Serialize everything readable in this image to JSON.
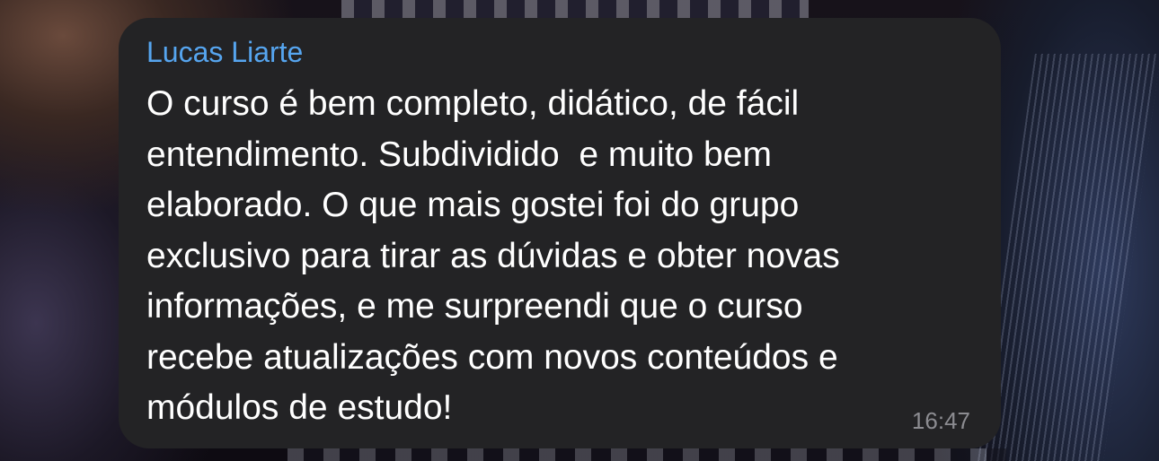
{
  "message": {
    "sender": "Lucas Liarte",
    "lines": [
      "O curso é bem completo, didático, de fácil",
      "entendimento. Subdividido  e muito bem",
      "elaborado. O que mais gostei foi do grupo",
      "exclusivo para tirar as dúvidas e obter novas",
      "informações, e me surpreendi que o curso",
      "recebe atualizações com novos conteúdos e",
      "módulos de estudo!"
    ],
    "time": "16:47"
  },
  "colors": {
    "bubble": "#232325",
    "sender_name": "#56a5ef",
    "text": "#ffffff",
    "time": "#8c8c91"
  }
}
